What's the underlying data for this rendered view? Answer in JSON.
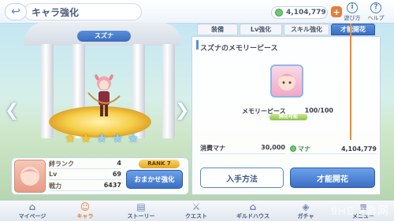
{
  "header": {
    "title": "キャラ強化",
    "mana": "4,104,779",
    "plus_label": "+",
    "help1_label": "遊び方",
    "help2_label": "ヘルプ"
  },
  "character": {
    "name": "スズナ",
    "stars_on": 2,
    "stars_total": 5
  },
  "stats": {
    "rows": [
      {
        "label": "絆ランク",
        "value": "4"
      },
      {
        "label": "Lv",
        "value": "69"
      },
      {
        "label": "戦力",
        "value": "6437"
      }
    ],
    "rank_label": "RANK",
    "rank_value": "7",
    "auto_button": "おまかせ強化"
  },
  "tabs": [
    "装備",
    "Lv強化",
    "スキル強化",
    "才能開花"
  ],
  "active_tab": 3,
  "memory_piece": {
    "title": "スズナのメモリーピース",
    "label": "メモリーピース",
    "count": "100/100",
    "fill": 1.0,
    "status": "開花可能"
  },
  "cost": {
    "required_label": "消費マナ",
    "required_value": "30,000",
    "owned_label": "マナ",
    "owned_value": "4,104,779"
  },
  "actions": {
    "how_to_obtain": "入手方法",
    "talent_bloom": "才能開花"
  },
  "bottom_nav": [
    {
      "label": "マイページ"
    },
    {
      "label": "キャラ"
    },
    {
      "label": "ストーリー"
    },
    {
      "label": "クエスト"
    },
    {
      "label": "ギルドハウス"
    },
    {
      "label": "ガチャ"
    },
    {
      "label": "メニュー"
    }
  ],
  "watermark": "9HE 9游网",
  "colors": {
    "accent_blue": "#3d6fc5",
    "highlight_orange": "#f08a2c",
    "star_gold": "#f4c531"
  }
}
